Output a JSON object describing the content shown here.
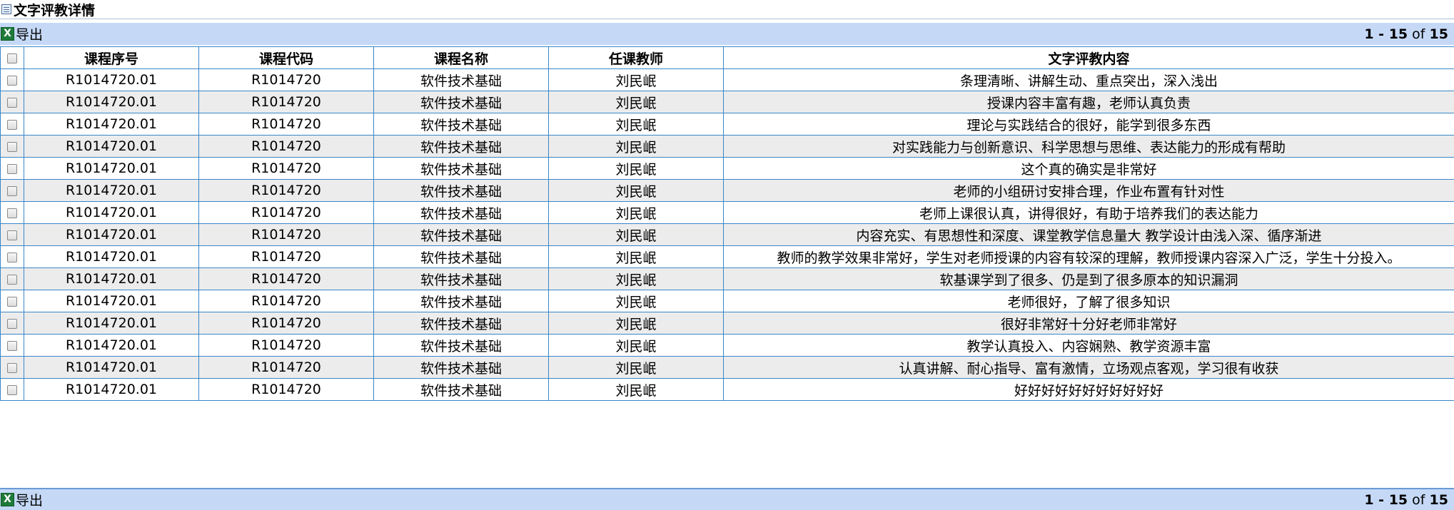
{
  "page": {
    "title": "文字评教详情"
  },
  "toolbar": {
    "export_label": "导出",
    "xls_icon": "excel-icon",
    "pager": {
      "from": "1",
      "sep": " - ",
      "to": "15",
      "of": " of ",
      "total": "15"
    }
  },
  "table": {
    "columns": [
      "课程序号",
      "课程代码",
      "课程名称",
      "任课教师",
      "文字评教内容"
    ],
    "rows": [
      [
        "R1014720.01",
        "R1014720",
        "软件技术基础",
        "刘民岷",
        "条理清晰、讲解生动、重点突出，深入浅出"
      ],
      [
        "R1014720.01",
        "R1014720",
        "软件技术基础",
        "刘民岷",
        "授课内容丰富有趣，老师认真负责"
      ],
      [
        "R1014720.01",
        "R1014720",
        "软件技术基础",
        "刘民岷",
        "理论与实践结合的很好，能学到很多东西"
      ],
      [
        "R1014720.01",
        "R1014720",
        "软件技术基础",
        "刘民岷",
        "对实践能力与创新意识、科学思想与思维、表达能力的形成有帮助"
      ],
      [
        "R1014720.01",
        "R1014720",
        "软件技术基础",
        "刘民岷",
        "这个真的确实是非常好"
      ],
      [
        "R1014720.01",
        "R1014720",
        "软件技术基础",
        "刘民岷",
        "老师的小组研讨安排合理，作业布置有针对性"
      ],
      [
        "R1014720.01",
        "R1014720",
        "软件技术基础",
        "刘民岷",
        "老师上课很认真，讲得很好，有助于培养我们的表达能力"
      ],
      [
        "R1014720.01",
        "R1014720",
        "软件技术基础",
        "刘民岷",
        "内容充实、有思想性和深度、课堂教学信息量大 教学设计由浅入深、循序渐进"
      ],
      [
        "R1014720.01",
        "R1014720",
        "软件技术基础",
        "刘民岷",
        "教师的教学效果非常好，学生对老师授课的内容有较深的理解，教师授课内容深入广泛，学生十分投入。"
      ],
      [
        "R1014720.01",
        "R1014720",
        "软件技术基础",
        "刘民岷",
        "软基课学到了很多、仍是到了很多原本的知识漏洞"
      ],
      [
        "R1014720.01",
        "R1014720",
        "软件技术基础",
        "刘民岷",
        "老师很好，了解了很多知识"
      ],
      [
        "R1014720.01",
        "R1014720",
        "软件技术基础",
        "刘民岷",
        "很好非常好十分好老师非常好"
      ],
      [
        "R1014720.01",
        "R1014720",
        "软件技术基础",
        "刘民岷",
        "教学认真投入、内容娴熟、教学资源丰富"
      ],
      [
        "R1014720.01",
        "R1014720",
        "软件技术基础",
        "刘民岷",
        "认真讲解、耐心指导、富有激情，立场观点客观，学习很有收获"
      ],
      [
        "R1014720.01",
        "R1014720",
        "软件技术基础",
        "刘民岷",
        "好好好好好好好好好好好"
      ]
    ]
  }
}
